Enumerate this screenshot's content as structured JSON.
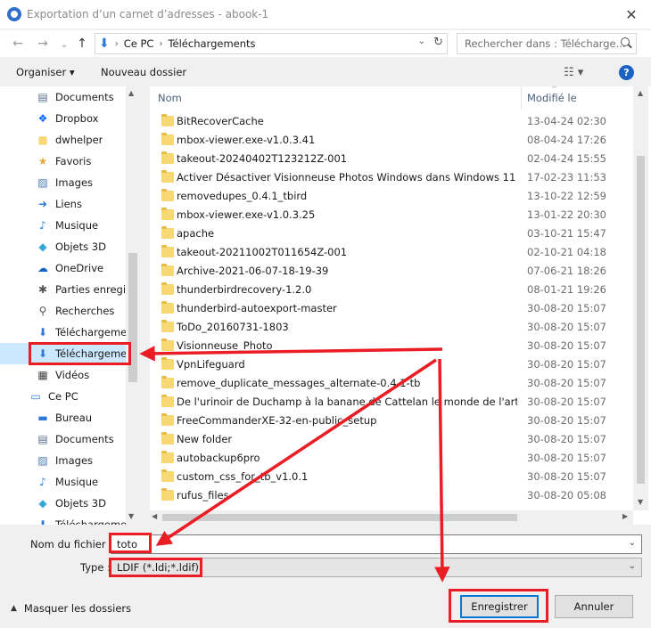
{
  "window": {
    "title": "Exportation d’un carnet d’adresses - abook-1",
    "close_glyph": "✕"
  },
  "address_bar": {
    "back_glyph": "←",
    "forward_glyph": "→",
    "recent_glyph": "⌄",
    "up_glyph": "↑",
    "crumbs": [
      "Ce PC",
      "Téléchargements"
    ],
    "search_placeholder": "Rechercher dans : Télécharge..."
  },
  "toolbar": {
    "organize_label": "Organiser ▾",
    "new_folder_label": "Nouveau dossier",
    "view_glyph": "☷ ▾",
    "help_glyph": "?"
  },
  "nav_pane": {
    "items": [
      {
        "label": "Documents",
        "icon": "documents-icon",
        "glyph": "▤",
        "color": "#5a6f8c"
      },
      {
        "label": "Dropbox",
        "icon": "dropbox-icon",
        "glyph": "❖",
        "color": "#0061fe"
      },
      {
        "label": "dwhelper",
        "icon": "folder-icon",
        "glyph": "■",
        "color": "#f8d775"
      },
      {
        "label": "Favoris",
        "icon": "star-icon",
        "glyph": "★",
        "color": "#e7a93a"
      },
      {
        "label": "Images",
        "icon": "images-icon",
        "glyph": "▨",
        "color": "#4a7ab5"
      },
      {
        "label": "Liens",
        "icon": "link-icon",
        "glyph": "➜",
        "color": "#2a79d8"
      },
      {
        "label": "Musique",
        "icon": "music-icon",
        "glyph": "♪",
        "color": "#2a79d8"
      },
      {
        "label": "Objets 3D",
        "icon": "cube-icon",
        "glyph": "◆",
        "color": "#36a6d6"
      },
      {
        "label": "OneDrive",
        "icon": "cloud-icon",
        "glyph": "☁",
        "color": "#0a64c8"
      },
      {
        "label": "Parties enregistrées",
        "icon": "puzzle-icon",
        "glyph": "✱",
        "color": "#555555"
      },
      {
        "label": "Recherches",
        "icon": "search-icon",
        "glyph": "⚲",
        "color": "#555555"
      },
      {
        "label": "Téléchargements",
        "icon": "download-icon",
        "glyph": "⬇",
        "color": "#2a79d8"
      },
      {
        "label": "Téléchargements",
        "icon": "download-icon",
        "glyph": "⬇",
        "color": "#2a79d8"
      },
      {
        "label": "Vidéos",
        "icon": "video-icon",
        "glyph": "▦",
        "color": "#444444"
      },
      {
        "label": "Ce PC",
        "icon": "computer-icon",
        "glyph": "▭",
        "color": "#2a79d8"
      },
      {
        "label": "Bureau",
        "icon": "desktop-icon",
        "glyph": "▬",
        "color": "#2a79d8"
      },
      {
        "label": "Documents",
        "icon": "documents-icon",
        "glyph": "▤",
        "color": "#5a6f8c"
      },
      {
        "label": "Images",
        "icon": "images-icon",
        "glyph": "▨",
        "color": "#4a7ab5"
      },
      {
        "label": "Musique",
        "icon": "music-icon",
        "glyph": "♪",
        "color": "#2a79d8"
      },
      {
        "label": "Objets 3D",
        "icon": "cube-icon",
        "glyph": "◆",
        "color": "#36a6d6"
      },
      {
        "label": "Téléchargements",
        "icon": "download-icon",
        "glyph": "⬇",
        "color": "#2a79d8"
      }
    ],
    "scroll_up_glyph": "▲",
    "scroll_down_glyph": "▼"
  },
  "file_list": {
    "columns": {
      "name": "Nom",
      "modified": "Modifié le",
      "sort_glyph": "^"
    },
    "rows": [
      {
        "name": "BitRecoverCache",
        "date": "13-04-24 02:30"
      },
      {
        "name": "mbox-viewer.exe-v1.0.3.41",
        "date": "08-04-24 17:26"
      },
      {
        "name": "takeout-20240402T123212Z-001",
        "date": "02-04-24 15:55"
      },
      {
        "name": "Activer Désactiver Visionneuse Photos Windows dans Windows 11",
        "date": "17-02-23 11:53"
      },
      {
        "name": "removedupes_0.4.1_tbird",
        "date": "13-10-22 12:59"
      },
      {
        "name": "mbox-viewer.exe-v1.0.3.25",
        "date": "13-01-22 20:30"
      },
      {
        "name": "apache",
        "date": "03-10-21 15:47"
      },
      {
        "name": "takeout-20211002T011654Z-001",
        "date": "02-10-21 04:18"
      },
      {
        "name": "Archive-2021-06-07-18-19-39",
        "date": "07-06-21 18:26"
      },
      {
        "name": "thunderbirdrecovery-1.2.0",
        "date": "08-01-21 19:26"
      },
      {
        "name": "thunderbird-autoexport-master",
        "date": "30-08-20 15:07"
      },
      {
        "name": "ToDo_20160731-1803",
        "date": "30-08-20 15:07"
      },
      {
        "name": "Visionneuse_Photo",
        "date": "30-08-20 15:07"
      },
      {
        "name": "VpnLifeguard",
        "date": "30-08-20 15:07"
      },
      {
        "name": "remove_duplicate_messages_alternate-0.4.1-tb",
        "date": "30-08-20 15:07"
      },
      {
        "name": "De l'urinoir de Duchamp à la banane de Cattelan   le monde de l'art s'e...",
        "date": "30-08-20 15:07"
      },
      {
        "name": "FreeCommanderXE-32-en-public_setup",
        "date": "30-08-20 15:07"
      },
      {
        "name": "New folder",
        "date": "30-08-20 15:07"
      },
      {
        "name": "autobackup6pro",
        "date": "30-08-20 15:07"
      },
      {
        "name": "custom_css_for_tb_v1.0.1",
        "date": "30-08-20 15:07"
      },
      {
        "name": "rufus_files",
        "date": "30-08-20 05:08"
      }
    ]
  },
  "form": {
    "filename_label": "Nom du fichier :",
    "filename_value": "toto",
    "type_label": "Type :",
    "type_value": "LDIF (*.ldi;*.ldif)",
    "dropdown_glyph": "⌄"
  },
  "footer": {
    "hide_folders_label": "Masquer les dossiers",
    "hide_caret": "▲",
    "save_label": "Enregistrer",
    "cancel_label": "Annuler"
  },
  "colors": {
    "annotation_red": "#ea1c24",
    "selection_blue": "#cce8ff",
    "accent_blue": "#0078d7"
  }
}
